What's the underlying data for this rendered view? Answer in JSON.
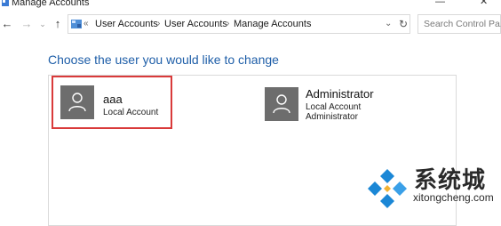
{
  "window": {
    "title": "Manage Accounts",
    "controls": {
      "minimize": "—",
      "close": "✕"
    }
  },
  "nav": {
    "back_icon": "back-arrow-icon",
    "forward_icon": "forward-arrow-icon",
    "recent_icon": "chevron-down-icon",
    "up_icon": "up-arrow-icon"
  },
  "address": {
    "overflow": "«",
    "crumbs": [
      "User Accounts",
      "User Accounts",
      "Manage Accounts"
    ],
    "separator": "›",
    "dropdown": "⌄",
    "refresh": "↻"
  },
  "search": {
    "placeholder": "Search Control Pa..."
  },
  "main": {
    "heading": "Choose the user you would like to change",
    "accounts": [
      {
        "name": "aaa",
        "lines": [
          "Local Account"
        ],
        "selected": true
      },
      {
        "name": "Administrator",
        "lines": [
          "Local Account",
          "Administrator"
        ],
        "selected": false
      }
    ]
  },
  "watermark": {
    "brand": "系统城",
    "url": "xitongcheng.com"
  },
  "colors": {
    "heading": "#1e5ea8",
    "selection": "#d93a3a",
    "avatar": "#6d6d6d",
    "logo": "#1b87d6"
  }
}
